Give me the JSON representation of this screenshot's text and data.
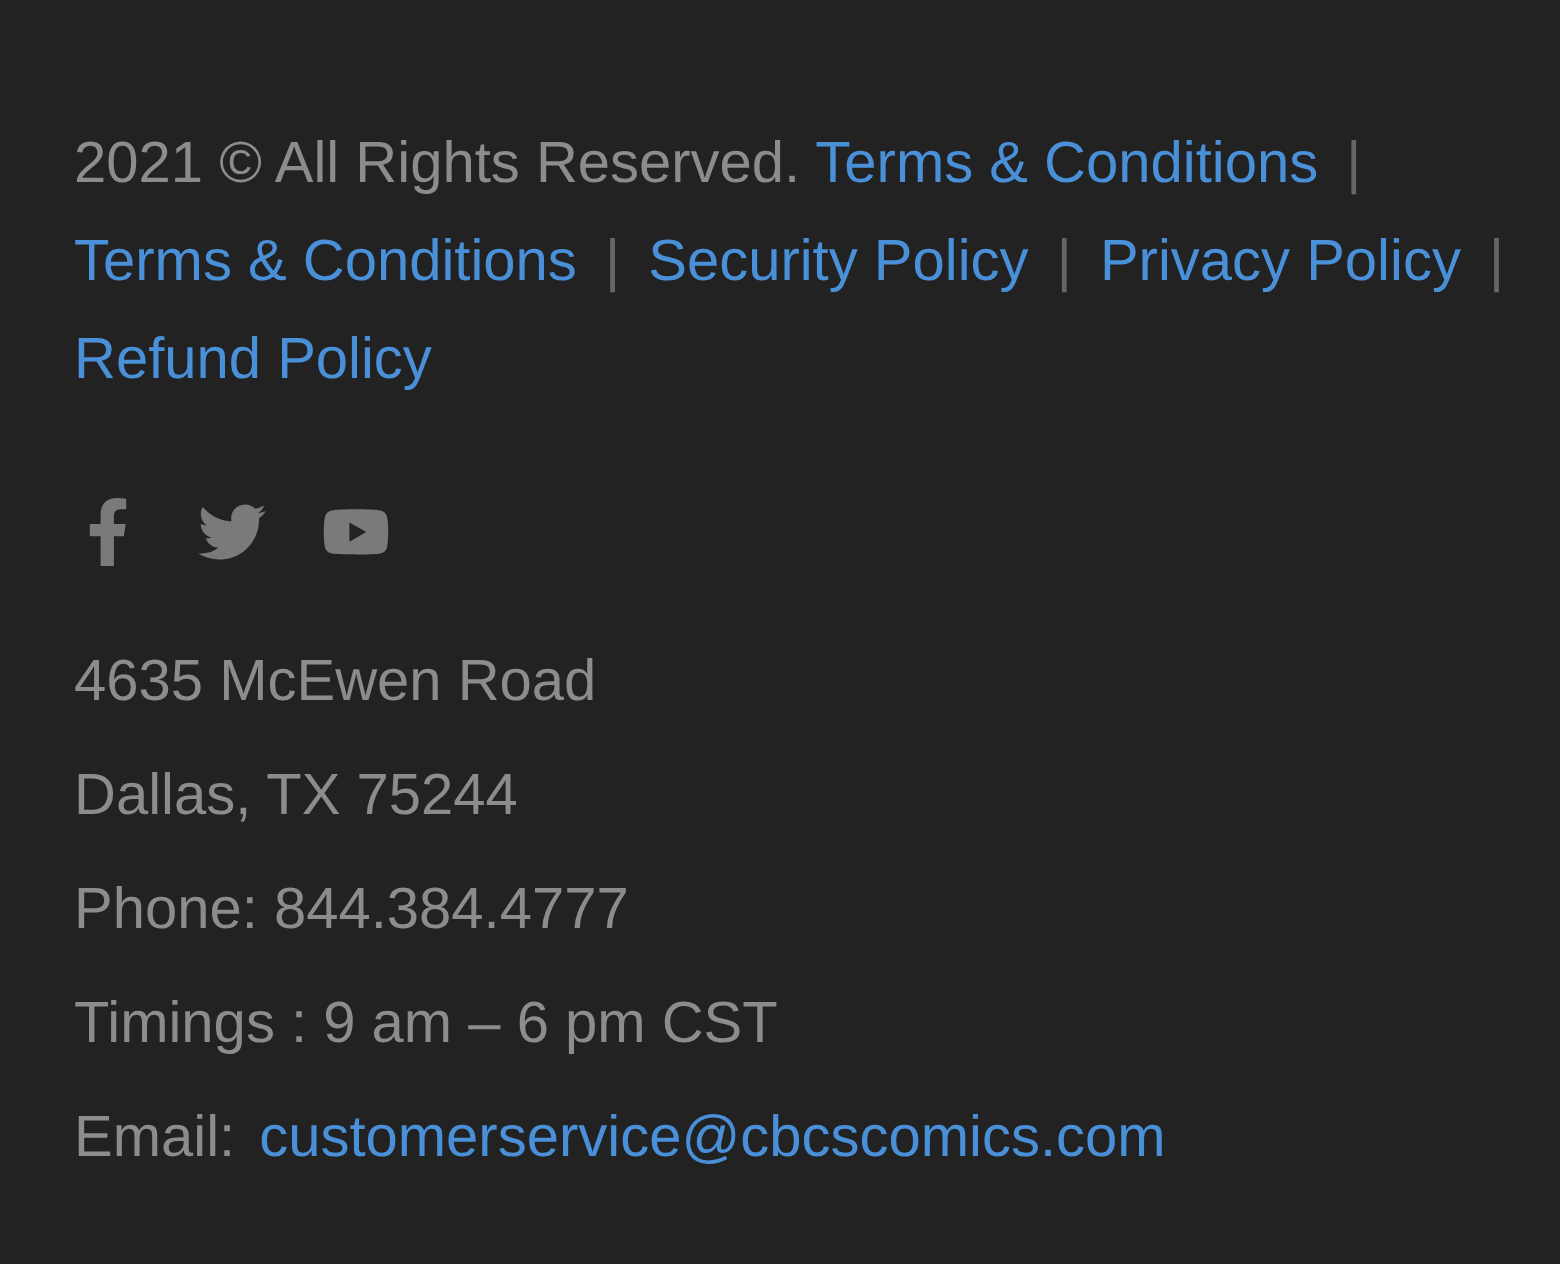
{
  "copyright": "2021 © All Rights Reserved.",
  "links": [
    {
      "label": "Terms & Conditions",
      "separator": "|"
    },
    {
      "label": "Terms & Conditions",
      "separator": "|"
    },
    {
      "label": "Security Policy",
      "separator": "|"
    },
    {
      "label": "Privacy Policy",
      "separator": "|"
    },
    {
      "label": "Refund Policy"
    }
  ],
  "social": [
    {
      "kind": "facebook"
    },
    {
      "kind": "twitter"
    },
    {
      "kind": "youtube"
    }
  ],
  "address_lines": [
    "4635 McEwen Road",
    "Dallas, TX 75244",
    "Phone: 844.384.4777",
    "Timings : 9 am – 6 pm CST"
  ],
  "email": {
    "label": "Email:",
    "value": "customerservice@cbcscomics.com"
  }
}
